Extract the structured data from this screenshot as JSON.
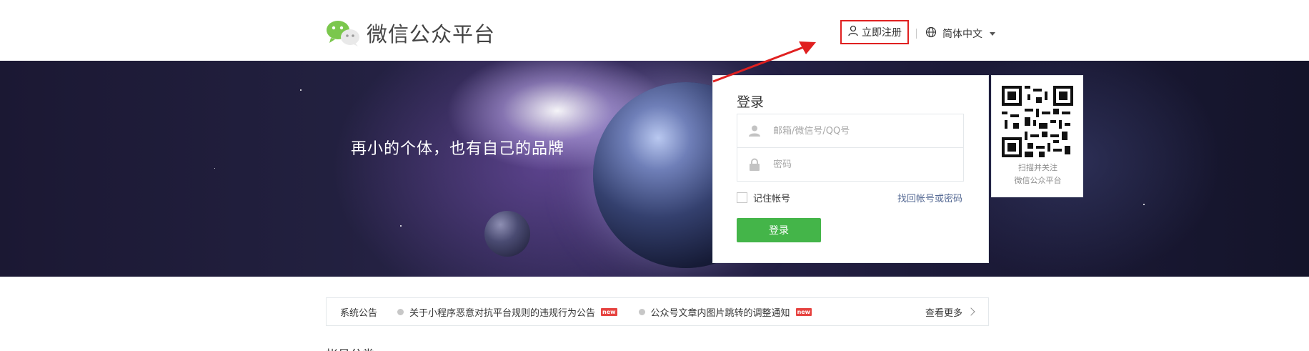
{
  "header": {
    "title": "微信公众平台",
    "register_label": "立即注册",
    "language_label": "简体中文",
    "icons": {
      "logo": "wechat-logo",
      "register": "user-icon",
      "language": "globe-icon",
      "dropdown": "caret-down-icon"
    }
  },
  "banner": {
    "slogan": "再小的个体，也有自己的品牌"
  },
  "login": {
    "title": "登录",
    "account_placeholder": "邮箱/微信号/QQ号",
    "password_placeholder": "密码",
    "remember_label": "记住帐号",
    "forgot_label": "找回帐号或密码",
    "submit_label": "登录",
    "icons": {
      "account": "user-icon",
      "password": "lock-icon"
    },
    "colors": {
      "button": "#44b549",
      "link": "#576b95"
    }
  },
  "qr": {
    "line1": "扫描并关注",
    "line2": "微信公众平台"
  },
  "annotation": {
    "highlight_color": "#e02020"
  },
  "notice": {
    "label": "系统公告",
    "items": [
      {
        "text": "关于小程序恶意对抗平台规则的违规行为公告",
        "badge": "new"
      },
      {
        "text": "公众号文章内图片跳转的调整通知",
        "badge": "new"
      }
    ],
    "more_label": "查看更多",
    "icons": {
      "more": "chevron-right-icon"
    }
  },
  "section": {
    "heading": "帐号分类"
  }
}
